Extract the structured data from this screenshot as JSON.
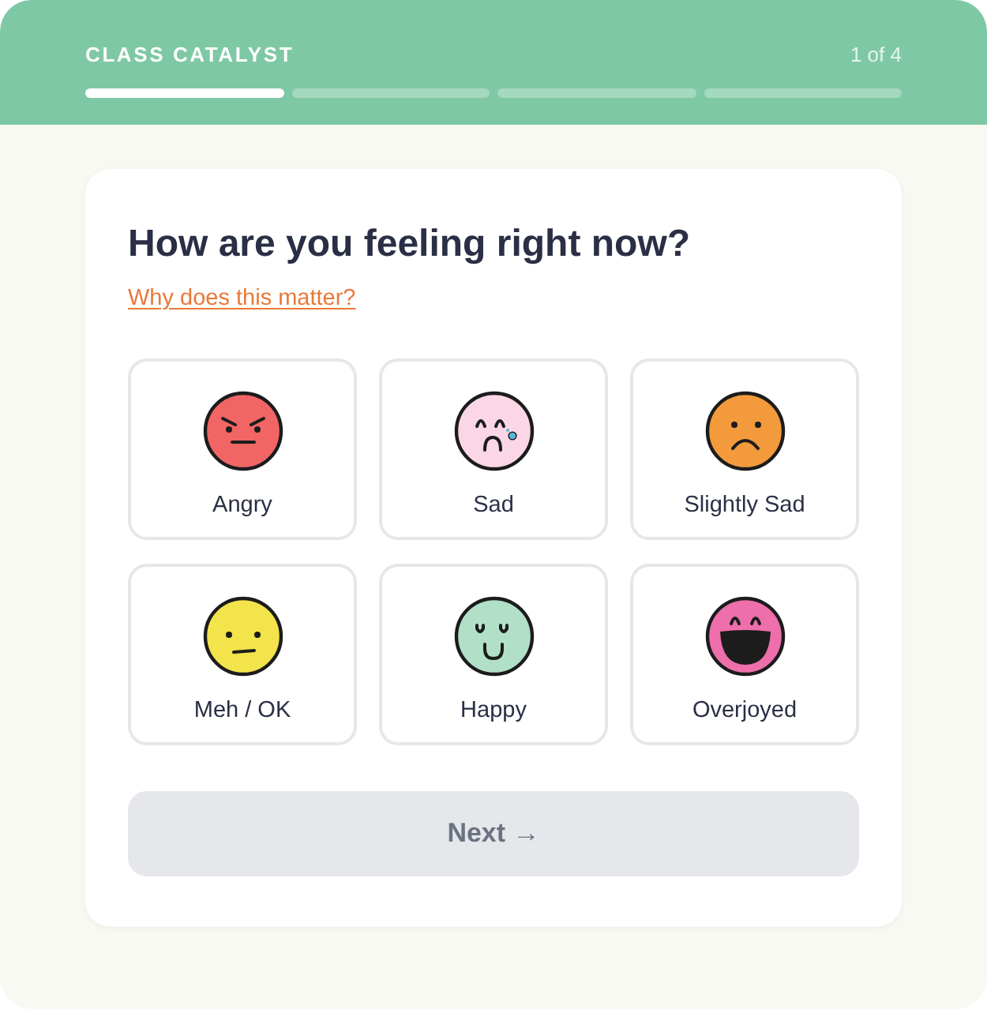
{
  "header": {
    "brand": "CLASS CATALYST",
    "step_label": "1 of 4",
    "segments": [
      {
        "filled": true
      },
      {
        "filled": false
      },
      {
        "filled": false
      },
      {
        "filled": false
      }
    ]
  },
  "question": {
    "title": "How are you feeling right now?",
    "help_link": "Why does this matter?"
  },
  "moods": [
    {
      "kind": "angry",
      "label": "Angry",
      "color": "#f26565",
      "selected": false
    },
    {
      "kind": "crying",
      "label": "Sad",
      "color": "#fbd6e6",
      "selected": false
    },
    {
      "kind": "frowning",
      "label": "Slightly Sad",
      "color": "#f39a3c",
      "selected": false
    },
    {
      "kind": "neutral",
      "label": "Meh / OK",
      "color": "#f2e44a",
      "selected": false
    },
    {
      "kind": "smiling",
      "label": "Happy",
      "color": "#b2dfc8",
      "selected": false
    },
    {
      "kind": "laughing",
      "label": "Overjoyed",
      "color": "#ee6fab",
      "selected": false
    }
  ],
  "next_button": {
    "label": "Next →",
    "disabled": true
  }
}
